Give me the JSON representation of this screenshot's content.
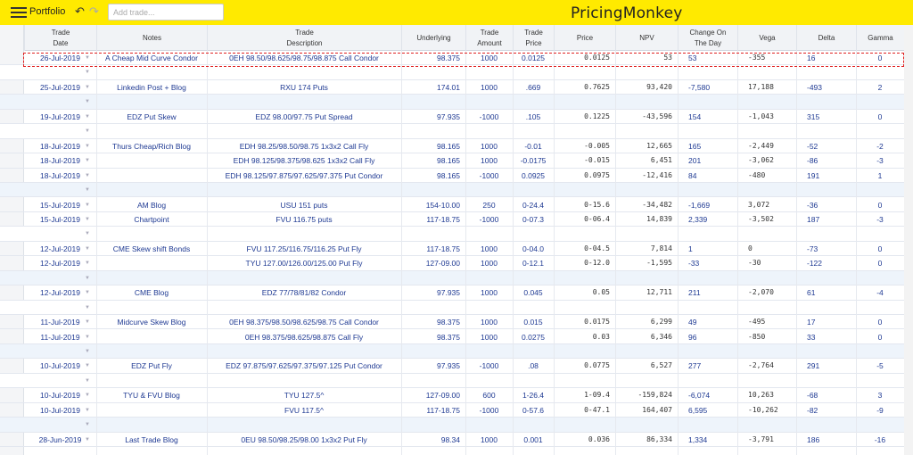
{
  "toolbar": {
    "portfolio_label": "Portfolio",
    "add_trade_placeholder": "Add trade...",
    "brand": "PricingMonkey",
    "undo_icon": "↶",
    "redo_icon": "↷"
  },
  "columns": [
    {
      "label": "Trade\nDate"
    },
    {
      "label": "Notes"
    },
    {
      "label": "Trade\nDescription"
    },
    {
      "label": "Underlying"
    },
    {
      "label": "Trade\nAmount"
    },
    {
      "label": "Trade\nPrice"
    },
    {
      "label": "Price"
    },
    {
      "label": "NPV"
    },
    {
      "label": "Change On\nThe Day"
    },
    {
      "label": "Vega"
    },
    {
      "label": "Delta"
    },
    {
      "label": "Gamma"
    }
  ],
  "rows": [
    {
      "date": "26-Jul-2019",
      "notes": "A Cheap Mid Curve Condor",
      "desc": "0EH 98.50/98.625/98.75/98.875 Call Condor",
      "und": "98.375",
      "amt": "1000",
      "tp": "0.0125",
      "price": "0.0125",
      "npv": "53",
      "chg": "53",
      "vega": "-355",
      "delta": "16",
      "gamma": "0"
    },
    {
      "spacer": true
    },
    {
      "date": "25-Jul-2019",
      "notes": "Linkedin Post + Blog",
      "desc": "RXU 174 Puts",
      "und": "174.01",
      "amt": "1000",
      "tp": ".669",
      "price": "0.7625",
      "npv": "93,420",
      "chg": "-7,580",
      "vega": "17,188",
      "delta": "-493",
      "gamma": "2"
    },
    {
      "spacer": true
    },
    {
      "date": "19-Jul-2019",
      "notes": "EDZ Put Skew",
      "desc": "EDZ 98.00/97.75 Put Spread",
      "und": "97.935",
      "amt": "-1000",
      "tp": ".105",
      "price": "0.1225",
      "npv": "-43,596",
      "chg": "154",
      "vega": "-1,043",
      "delta": "315",
      "gamma": "0"
    },
    {
      "spacer": true
    },
    {
      "date": "18-Jul-2019",
      "notes": "Thurs Cheap/Rich Blog",
      "desc": "EDH 98.25/98.50/98.75 1x3x2 Call Fly",
      "und": "98.165",
      "amt": "1000",
      "tp": "-0.01",
      "price": "-0.005",
      "npv": "12,665",
      "chg": "165",
      "vega": "-2,449",
      "delta": "-52",
      "gamma": "-2"
    },
    {
      "date": "18-Jul-2019",
      "notes": "",
      "desc": "EDH 98.125/98.375/98.625 1x3x2 Call Fly",
      "und": "98.165",
      "amt": "1000",
      "tp": "-0.0175",
      "price": "-0.015",
      "npv": "6,451",
      "chg": "201",
      "vega": "-3,062",
      "delta": "-86",
      "gamma": "-3"
    },
    {
      "date": "18-Jul-2019",
      "notes": "",
      "desc": "EDH 98.125/97.875/97.625/97.375 Put Condor",
      "und": "98.165",
      "amt": "-1000",
      "tp": "0.0925",
      "price": "0.0975",
      "npv": "-12,416",
      "chg": "84",
      "vega": "-480",
      "delta": "191",
      "gamma": "1"
    },
    {
      "spacer": true
    },
    {
      "date": "15-Jul-2019",
      "notes": "AM Blog",
      "desc": "USU 151 puts",
      "und": "154-10.00",
      "amt": "250",
      "tp": "0-24.4",
      "price": "0-15.6",
      "npv": "-34,482",
      "chg": "-1,669",
      "vega": "3,072",
      "delta": "-36",
      "gamma": "0"
    },
    {
      "date": "15-Jul-2019",
      "notes": "Chartpoint",
      "desc": "FVU 116.75 puts",
      "und": "117-18.75",
      "amt": "-1000",
      "tp": "0-07.3",
      "price": "0-06.4",
      "npv": "14,839",
      "chg": "2,339",
      "vega": "-3,502",
      "delta": "187",
      "gamma": "-3"
    },
    {
      "spacer": true
    },
    {
      "date": "12-Jul-2019",
      "notes": "CME Skew shift Bonds",
      "desc": "FVU 117.25/116.75/116.25 Put Fly",
      "und": "117-18.75",
      "amt": "1000",
      "tp": "0-04.0",
      "price": "0-04.5",
      "npv": "7,814",
      "chg": "1",
      "vega": "0",
      "delta": "-73",
      "gamma": "0"
    },
    {
      "date": "12-Jul-2019",
      "notes": "",
      "desc": "TYU 127.00/126.00/125.00 Put Fly",
      "und": "127-09.00",
      "amt": "1000",
      "tp": "0-12.1",
      "price": "0-12.0",
      "npv": "-1,595",
      "chg": "-33",
      "vega": "-30",
      "delta": "-122",
      "gamma": "0"
    },
    {
      "spacer": true
    },
    {
      "date": "12-Jul-2019",
      "notes": "CME Blog",
      "desc": "EDZ 77/78/81/82 Condor",
      "und": "97.935",
      "amt": "1000",
      "tp": "0.045",
      "price": "0.05",
      "npv": "12,711",
      "chg": "211",
      "vega": "-2,070",
      "delta": "61",
      "gamma": "-4"
    },
    {
      "spacer": true
    },
    {
      "date": "11-Jul-2019",
      "notes": "Midcurve Skew Blog",
      "desc": "0EH 98.375/98.50/98.625/98.75 Call Condor",
      "und": "98.375",
      "amt": "1000",
      "tp": "0.015",
      "price": "0.0175",
      "npv": "6,299",
      "chg": "49",
      "vega": "-495",
      "delta": "17",
      "gamma": "0"
    },
    {
      "date": "11-Jul-2019",
      "notes": "",
      "desc": "0EH 98.375/98.625/98.875 Call Fly",
      "und": "98.375",
      "amt": "1000",
      "tp": "0.0275",
      "price": "0.03",
      "npv": "6,346",
      "chg": "96",
      "vega": "-850",
      "delta": "33",
      "gamma": "0"
    },
    {
      "spacer": true
    },
    {
      "date": "10-Jul-2019",
      "notes": "EDZ Put Fly",
      "desc": "EDZ 97.875/97.625/97.375/97.125 Put Condor",
      "und": "97.935",
      "amt": "-1000",
      "tp": ".08",
      "price": "0.0775",
      "npv": "6,527",
      "chg": "277",
      "vega": "-2,764",
      "delta": "291",
      "gamma": "-5"
    },
    {
      "spacer": true
    },
    {
      "date": "10-Jul-2019",
      "notes": "TYU & FVU Blog",
      "desc": "TYU 127.5^",
      "und": "127-09.00",
      "amt": "600",
      "tp": "1-26.4",
      "price": "1-09.4",
      "npv": "-159,824",
      "chg": "-6,074",
      "vega": "10,263",
      "delta": "-68",
      "gamma": "3"
    },
    {
      "date": "10-Jul-2019",
      "notes": "",
      "desc": "FVU 117.5^",
      "und": "117-18.75",
      "amt": "-1000",
      "tp": "0-57.6",
      "price": "0-47.1",
      "npv": "164,407",
      "chg": "6,595",
      "vega": "-10,262",
      "delta": "-82",
      "gamma": "-9"
    },
    {
      "spacer": true
    },
    {
      "date": "28-Jun-2019",
      "notes": "Last Trade Blog",
      "desc": "0EU 98.50/98.25/98.00 1x3x2 Put Fly",
      "und": "98.34",
      "amt": "1000",
      "tp": "0.001",
      "price": "0.036",
      "npv": "86,334",
      "chg": "1,334",
      "vega": "-3,791",
      "delta": "186",
      "gamma": "-16"
    }
  ]
}
